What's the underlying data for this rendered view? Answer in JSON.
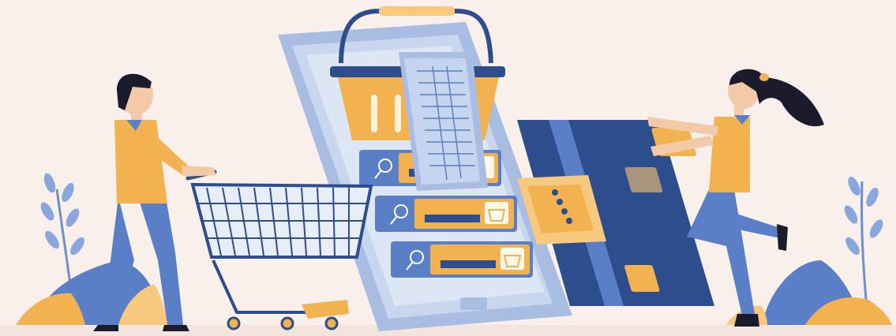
{
  "illustration": {
    "subject": "online-shopping",
    "colors": {
      "background": "#f9f0ec",
      "navy": "#2d4d8c",
      "blue": "#5a7fc6",
      "light_blue": "#a9bde3",
      "phone_blue": "#b5c8e6",
      "orange": "#f2b24f",
      "light_orange": "#f7c97e",
      "skin": "#f3c9a8",
      "dark": "#1b1b2b"
    },
    "icons": [
      "shopping-basket",
      "receipt",
      "search-magnifier",
      "cart",
      "credit-card",
      "chip",
      "plant"
    ]
  }
}
